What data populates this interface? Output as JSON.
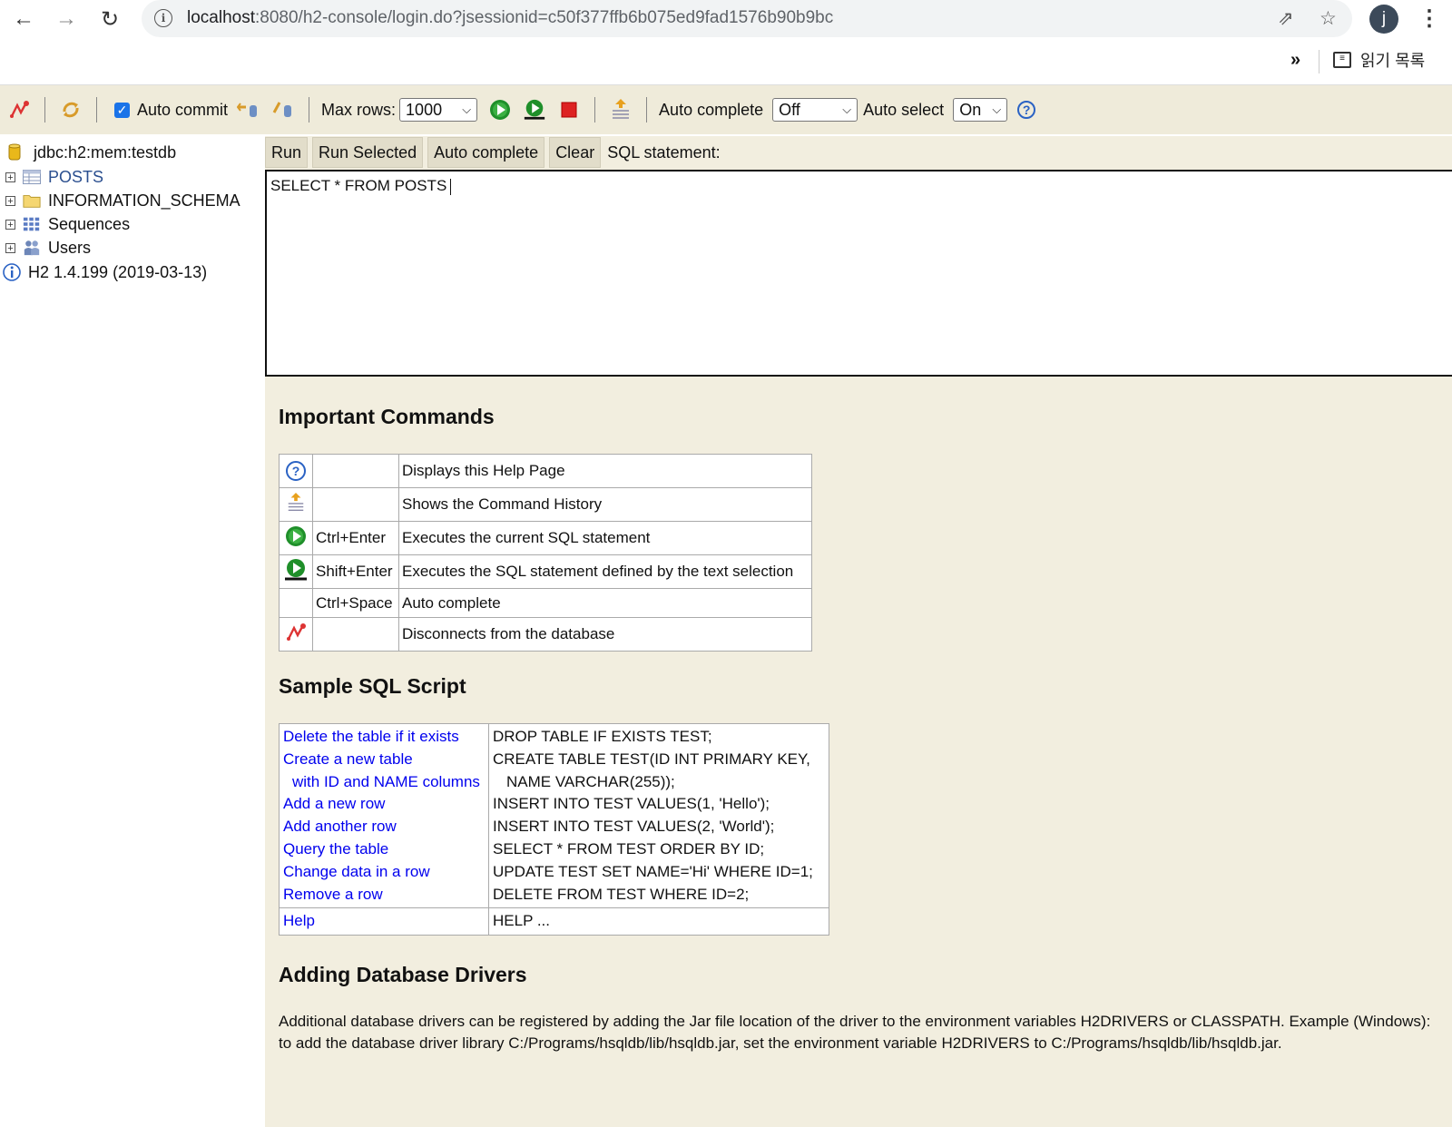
{
  "browser": {
    "url_host": "localhost",
    "url_path": ":8080/h2-console/login.do?jsessionid=c50f377ffb6b075ed9fad1576b90b9bc",
    "avatar_letter": "j",
    "overflow_chevron": "»",
    "reading_list_label": "읽기 목록"
  },
  "toolbar": {
    "auto_commit_label": "Auto commit",
    "auto_commit_checked": true,
    "max_rows_label": "Max rows:",
    "max_rows_value": "1000",
    "auto_complete_label": "Auto complete",
    "auto_complete_value": "Off",
    "auto_select_label": "Auto select",
    "auto_select_value": "On"
  },
  "tree": {
    "connection": "jdbc:h2:mem:testdb",
    "items": [
      {
        "label": "POSTS",
        "icon": "table-icon"
      },
      {
        "label": "INFORMATION_SCHEMA",
        "icon": "folder-icon"
      },
      {
        "label": "Sequences",
        "icon": "sequences-icon"
      },
      {
        "label": "Users",
        "icon": "users-icon"
      }
    ],
    "version": "H2 1.4.199 (2019-03-13)"
  },
  "sql_panel": {
    "run_label": "Run",
    "run_selected_label": "Run Selected",
    "auto_complete_label": "Auto complete",
    "clear_label": "Clear",
    "statement_label": "SQL statement:",
    "editor_text": "SELECT * FROM POSTS"
  },
  "help": {
    "important_commands_title": "Important Commands",
    "commands": [
      {
        "icon": "help-icon",
        "shortcut": "",
        "description": "Displays this Help Page"
      },
      {
        "icon": "history-icon",
        "shortcut": "",
        "description": "Shows the Command History"
      },
      {
        "icon": "run-icon",
        "shortcut": "Ctrl+Enter",
        "description": "Executes the current SQL statement"
      },
      {
        "icon": "run-selected-icon",
        "shortcut": "Shift+Enter",
        "description": "Executes the SQL statement defined by the text selection"
      },
      {
        "icon": "",
        "shortcut": "Ctrl+Space",
        "description": "Auto complete"
      },
      {
        "icon": "disconnect-icon",
        "shortcut": "",
        "description": "Disconnects from the database"
      }
    ],
    "sample_script_title": "Sample SQL Script",
    "sample_links": [
      "Delete the table if it exists",
      "Create a new table",
      "with ID and NAME columns",
      "Add a new row",
      "Add another row",
      "Query the table",
      "Change data in a row",
      "Remove a row"
    ],
    "sample_sql": [
      "DROP TABLE IF EXISTS TEST;",
      "CREATE TABLE TEST(ID INT PRIMARY KEY,",
      "NAME VARCHAR(255));",
      "INSERT INTO TEST VALUES(1, 'Hello');",
      "INSERT INTO TEST VALUES(2, 'World');",
      "SELECT * FROM TEST ORDER BY ID;",
      "UPDATE TEST SET NAME='Hi' WHERE ID=1;",
      "DELETE FROM TEST WHERE ID=2;"
    ],
    "help_link": "Help",
    "help_sql": "HELP ...",
    "drivers_title": "Adding Database Drivers",
    "drivers_text": "Additional database drivers can be registered by adding the Jar file location of the driver to the environment variables H2DRIVERS or CLASSPATH. Example (Windows): to add the database driver library C:/Programs/hsqldb/lib/hsqldb.jar, set the environment variable H2DRIVERS to C:/Programs/hsqldb/lib/hsqldb.jar."
  }
}
